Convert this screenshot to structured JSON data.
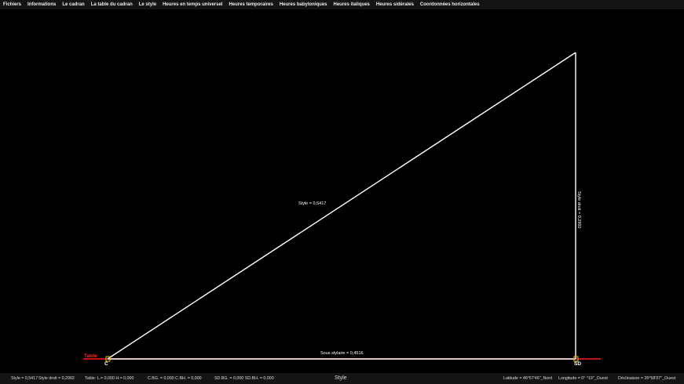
{
  "menubar": {
    "items": [
      {
        "label": "Fichiers"
      },
      {
        "label": "Informations"
      },
      {
        "label": "Le cadran"
      },
      {
        "label": "La table du cadran"
      },
      {
        "label": "Le style"
      },
      {
        "label": "Heures en temps universel"
      },
      {
        "label": "Heures temporaires"
      },
      {
        "label": "Heures babyloniques"
      },
      {
        "label": "Heures italiques"
      },
      {
        "label": "Heures sidérales"
      },
      {
        "label": "Coordonnées horizontales"
      }
    ]
  },
  "drawing": {
    "hypotenuse_label": "Style = 0,5417",
    "vertical_label": "Style droit = 0,2992",
    "base_label": "Sous stylaire = 0,4516",
    "table_label": "Table",
    "point_c_label": "C",
    "point_sd_label": "SD",
    "colors": {
      "line": "#ffffff",
      "table_line": "#ff1a1a",
      "table_text": "#ff2a2a",
      "point_marker": "#e8c800"
    }
  },
  "statusbar": {
    "style": "Style = 0,5417",
    "style_droit": "Style droit = 0,2992",
    "table": "Table:  L.= 0,000   H.= 0,000",
    "cbg": "C.BG. = 0,000   C.BH. = 0,000",
    "sdbg": "SD.BG. = 0,000   SD.BH. = 0,000",
    "mode": "Style",
    "latitude": "Latitude = 46°57'46\"_Nord",
    "longitude": "Longitude = 0°   °19\"_Ouest",
    "declinaison": "Déclinaison = 35°58'07\"_Ouest"
  }
}
